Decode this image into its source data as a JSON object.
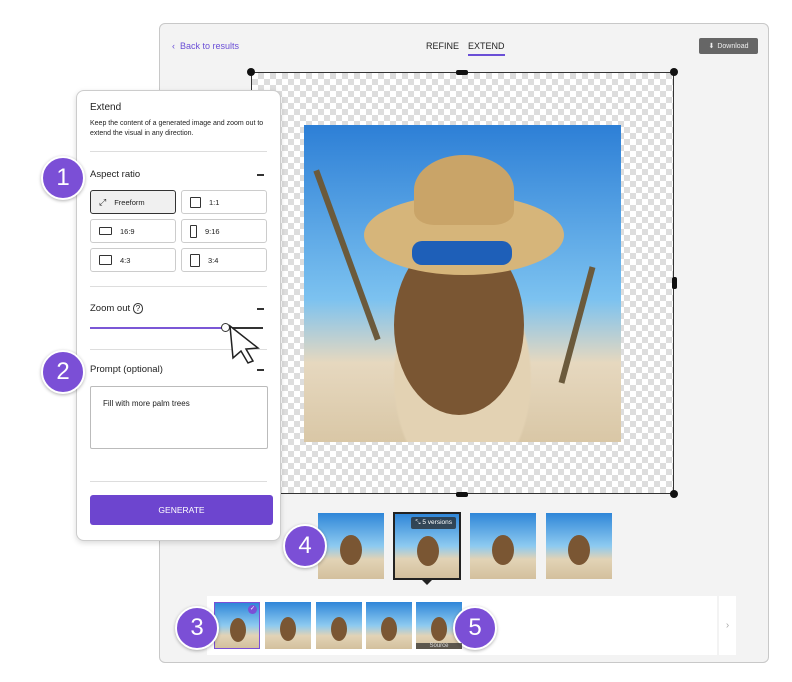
{
  "header": {
    "back": "Back to results",
    "tabs": [
      "REFINE",
      "EXTEND"
    ],
    "active_tab": "EXTEND",
    "download": "Download"
  },
  "panel": {
    "title": "Extend",
    "description": "Keep the content of a generated image and zoom out to extend the visual in any direction.",
    "aspect_ratio_label": "Aspect ratio",
    "options": [
      "Freeform",
      "1:1",
      "16:9",
      "9:16",
      "4:3",
      "3:4"
    ],
    "selected": "Freeform",
    "zoom_label": "Zoom out",
    "zoom_value_percent": 77,
    "prompt_label": "Prompt  (optional)",
    "prompt_value": "Fill with more palm trees",
    "generate": "GENERATE"
  },
  "variations": {
    "versions_label": "5 versions"
  },
  "history": {
    "source_label": "Source"
  },
  "badges": [
    "1",
    "2",
    "3",
    "4",
    "5"
  ],
  "colors": {
    "accent": "#6d45cf"
  }
}
